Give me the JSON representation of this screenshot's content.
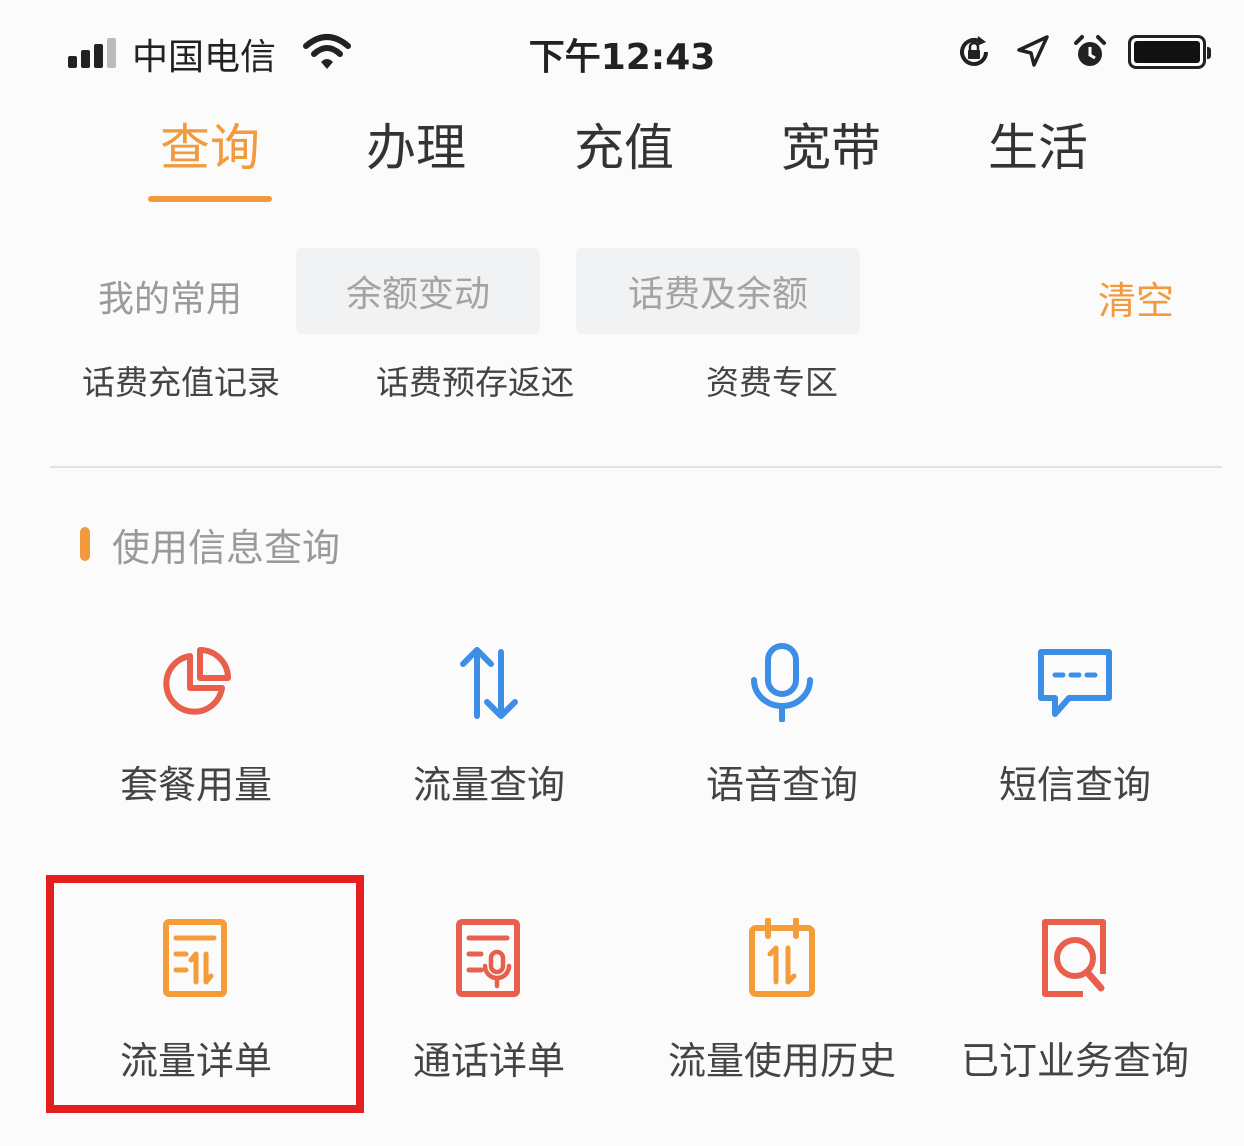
{
  "status_bar": {
    "carrier": "中国电信",
    "time": "下午12:43"
  },
  "tabs": [
    {
      "label": "查询",
      "active": true
    },
    {
      "label": "办理",
      "active": false
    },
    {
      "label": "充值",
      "active": false
    },
    {
      "label": "宽带",
      "active": false
    },
    {
      "label": "生活",
      "active": false
    }
  ],
  "favorites": {
    "title": "我的常用",
    "chips": [
      "余额变动",
      "话费及余额"
    ],
    "clear_label": "清空",
    "more_items": [
      "话费充值记录",
      "话费预存返还",
      "资费专区"
    ]
  },
  "section": {
    "title": "使用信息查询",
    "items": [
      {
        "label": "套餐用量",
        "icon": "pie-chart-icon",
        "color": "#e8604c"
      },
      {
        "label": "流量查询",
        "icon": "data-arrows-icon",
        "color": "#3d8ee6"
      },
      {
        "label": "语音查询",
        "icon": "microphone-icon",
        "color": "#3d8ee6"
      },
      {
        "label": "短信查询",
        "icon": "message-icon",
        "color": "#3d8ee6"
      },
      {
        "label": "流量详单",
        "icon": "data-detail-icon",
        "color": "#f39c38"
      },
      {
        "label": "通话详单",
        "icon": "call-detail-icon",
        "color": "#e8604c"
      },
      {
        "label": "流量使用历史",
        "icon": "calendar-history-icon",
        "color": "#f39c38"
      },
      {
        "label": "已订业务查询",
        "icon": "subscription-search-icon",
        "color": "#e8604c"
      }
    ]
  },
  "colors": {
    "accent": "#f19a3e",
    "highlight": "#e41f1f"
  }
}
